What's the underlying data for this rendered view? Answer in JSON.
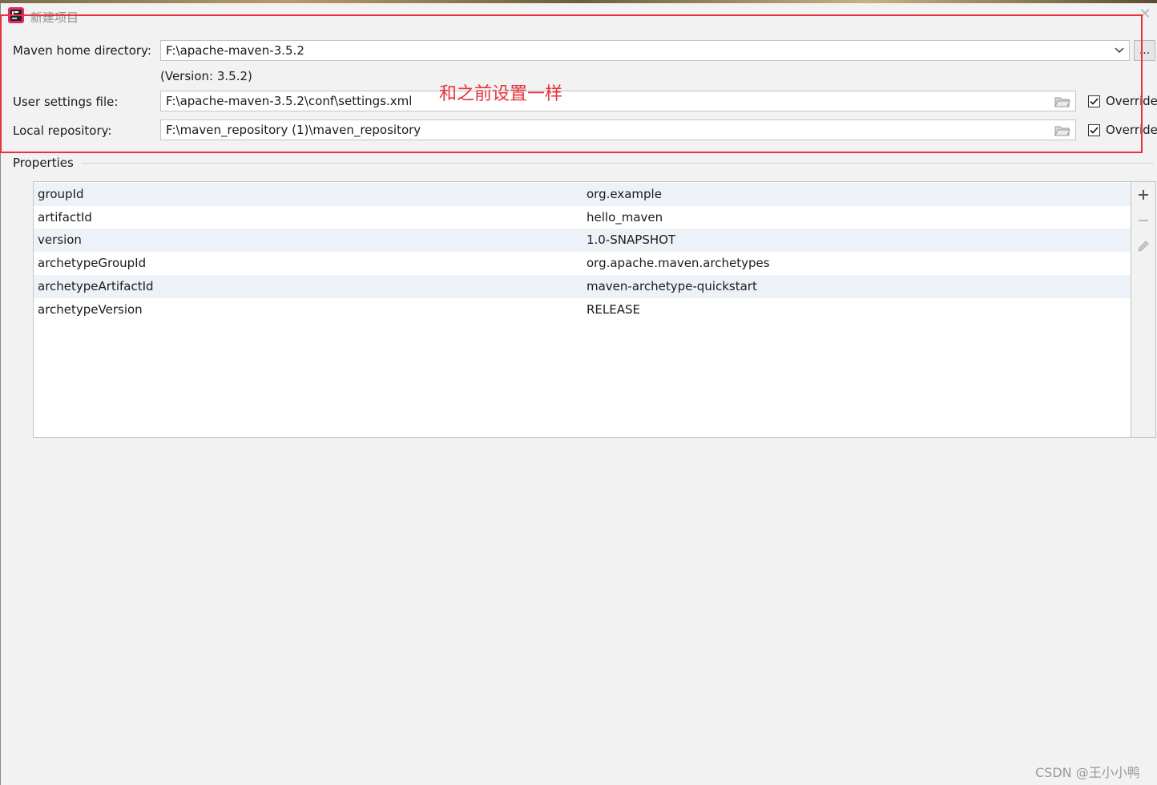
{
  "window": {
    "title": "新建项目",
    "close_symbol": "✕"
  },
  "maven": {
    "home_label": "Maven home directory:",
    "home_value": "F:\\apache-maven-3.5.2",
    "version_text": "(Version: 3.5.2)",
    "browse_label": "...",
    "settings_label": "User settings file:",
    "settings_value": "F:\\apache-maven-3.5.2\\conf\\settings.xml",
    "settings_override_label": "Override",
    "settings_override_checked": true,
    "repo_label": "Local repository:",
    "repo_value": "F:\\maven_repository (1)\\maven_repository",
    "repo_override_label": "Override",
    "repo_override_checked": true
  },
  "annotation": {
    "text": "和之前设置一样",
    "color": "#e8323c"
  },
  "properties": {
    "title": "Properties",
    "rows": [
      {
        "key": "groupId",
        "value": "org.example"
      },
      {
        "key": "artifactId",
        "value": "hello_maven"
      },
      {
        "key": "version",
        "value": "1.0-SNAPSHOT"
      },
      {
        "key": "archetypeGroupId",
        "value": "org.apache.maven.archetypes"
      },
      {
        "key": "archetypeArtifactId",
        "value": "maven-archetype-quickstart"
      },
      {
        "key": "archetypeVersion",
        "value": "RELEASE"
      }
    ],
    "tools": [
      "add-icon",
      "remove-icon",
      "edit-icon"
    ]
  },
  "watermark": "CSDN @王小小鸭"
}
